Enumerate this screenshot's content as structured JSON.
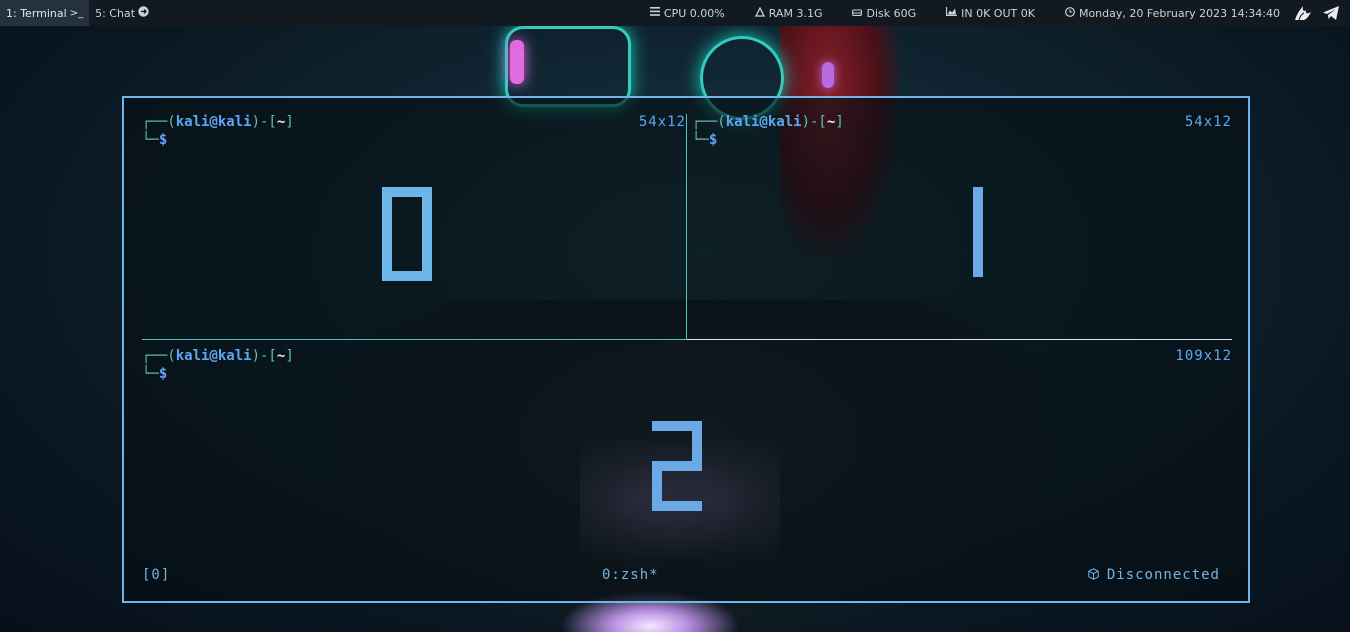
{
  "topbar": {
    "workspaces": [
      {
        "label": "1: Terminal",
        "glyph": ">_"
      },
      {
        "label": "5: Chat",
        "glyph": "➤"
      }
    ],
    "stats": {
      "cpu": "CPU 0.00%",
      "ram": "RAM 3.1G",
      "disk": "Disk 60G",
      "net": "IN 0K OUT 0K",
      "clock": "Monday, 20 February 2023 14:34:40"
    },
    "icons": {
      "cpu": "menu-icon",
      "ram": "memory-icon",
      "disk": "drive-icon",
      "net": "chart-icon",
      "clock": "clock-icon",
      "tray": [
        "burp-icon",
        "telegram-icon"
      ]
    },
    "accent": "#25313c"
  },
  "terminal": {
    "border_color": "#6fb5ea",
    "panes": [
      {
        "prompt_user": "kali@kali",
        "prompt_dir": "~",
        "prompt_symbol": "$",
        "size": "54x12",
        "number": "0"
      },
      {
        "prompt_user": "kali@kali",
        "prompt_dir": "~",
        "prompt_symbol": "$",
        "size": "54x12",
        "number": "1"
      },
      {
        "prompt_user": "kali@kali",
        "prompt_dir": "~",
        "prompt_symbol": "$",
        "size": "109x12",
        "number": "2"
      }
    ],
    "status": {
      "session": "[0]",
      "window": "0:zsh*",
      "connection": "Disconnected"
    }
  }
}
